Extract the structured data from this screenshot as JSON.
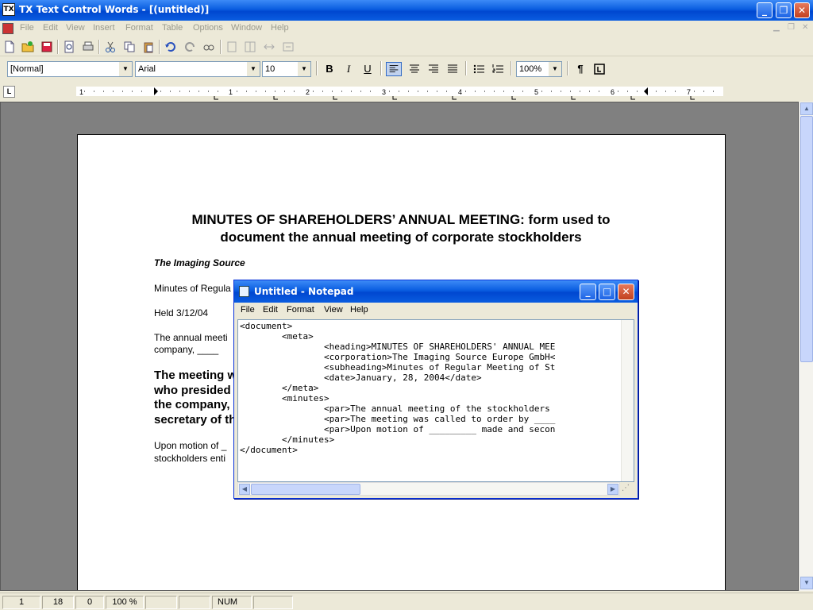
{
  "window": {
    "title": "TX Text Control Words - [(untitled)]",
    "app_icon_text": "TX"
  },
  "menu": [
    "File",
    "Edit",
    "View",
    "Insert",
    "Format",
    "Table",
    "Options",
    "Window",
    "Help"
  ],
  "format_bar": {
    "style": "[Normal]",
    "font": "Arial",
    "size": "10",
    "zoom": "100%",
    "bold": "B",
    "italic": "I",
    "underline": "U",
    "pilcrow": "¶"
  },
  "ruler": {
    "numbers": [
      "1",
      "1",
      "2",
      "3",
      "4",
      "5",
      "6",
      "7"
    ]
  },
  "document": {
    "heading_line1": "MINUTES OF SHAREHOLDERS’ ANNUAL MEETING: form used to",
    "heading_line2": "document the annual meeting of corporate stockholders",
    "corporation": "The Imaging Source",
    "subheading": "Minutes of Regula",
    "held": "Held 3/12/04",
    "par1_line1": "The annual meeti",
    "par1_line2": "company, ____",
    "par2_lines": [
      "The meeting w",
      "who presided",
      "the company,",
      "secretary of th"
    ],
    "par3_line1": "Upon motion of _",
    "par3_line2": "stockholders enti"
  },
  "status": {
    "page": "1",
    "line": "18",
    "column": "0",
    "zoom": "100 %",
    "num": "NUM"
  },
  "notepad": {
    "title": "Untitled - Notepad",
    "menu": [
      "File",
      "Edit",
      "Format",
      "View",
      "Help"
    ],
    "lines": [
      "<document>",
      "        <meta>",
      "                <heading>MINUTES OF SHAREHOLDERS' ANNUAL MEE",
      "                <corporation>The Imaging Source Europe GmbH<",
      "                <subheading>Minutes of Regular Meeting of St",
      "                <date>January, 28, 2004</date>",
      "        </meta>",
      "        <minutes>",
      "                <par>The annual meeting of the stockholders ",
      "                <par>The meeting was called to order by ____",
      "                <par>Upon motion of _________ made and secon",
      "        </minutes>",
      "</document>"
    ]
  },
  "colors": {
    "titlebar": "#0a5de0",
    "desktop_gray": "#808080",
    "chrome": "#ece9d8"
  }
}
